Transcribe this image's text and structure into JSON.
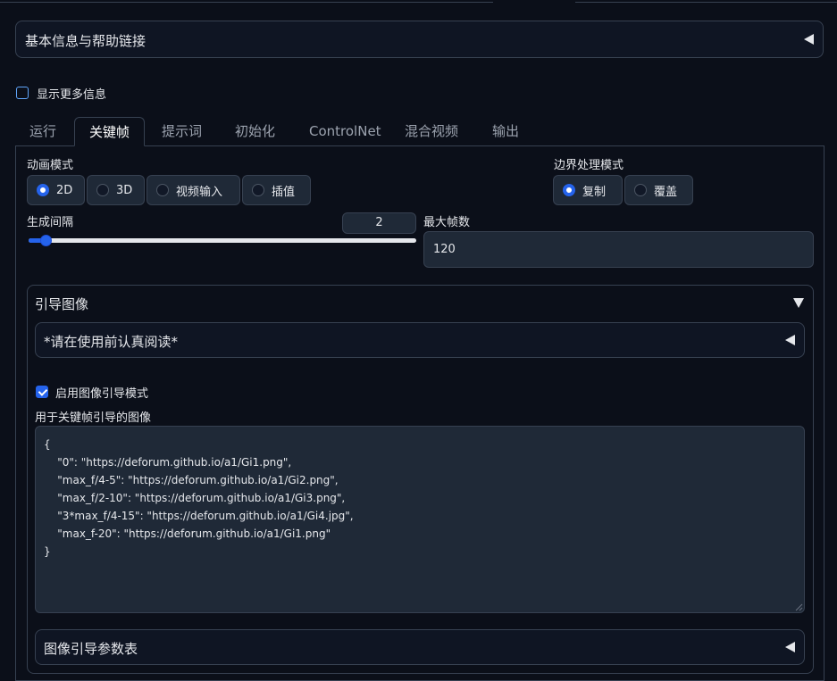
{
  "colors": {
    "accent": "#2563eb",
    "background": "#0b0f19",
    "border": "#374151",
    "input_bg": "#1f2937"
  },
  "top_accordion": {
    "title": "基本信息与帮助链接",
    "icon": "triangle-left-icon"
  },
  "show_more": {
    "label": "显示更多信息",
    "checked": false
  },
  "tabs": [
    {
      "label": "运行",
      "active": false
    },
    {
      "label": "关键帧",
      "active": true
    },
    {
      "label": "提示词",
      "active": false
    },
    {
      "label": "初始化",
      "active": false
    },
    {
      "label": "ControlNet",
      "active": false
    },
    {
      "label": "混合视频",
      "active": false
    },
    {
      "label": "输出",
      "active": false
    }
  ],
  "animation_mode": {
    "label": "动画模式",
    "options": [
      "2D",
      "3D",
      "视频输入",
      "插值"
    ],
    "selected": "2D"
  },
  "border_mode": {
    "label": "边界处理模式",
    "options": [
      "复制",
      "覆盖"
    ],
    "selected": "复制"
  },
  "cadence": {
    "label": "生成间隔",
    "value": "2",
    "fraction": 0.02
  },
  "max_frames": {
    "label": "最大帧数",
    "value": "120"
  },
  "guided_images": {
    "title": "引导图像",
    "readme_title": "*请在使用前认真阅读*",
    "enable_label": "启用图像引导模式",
    "enable_checked": true,
    "images_label": "用于关键帧引导的图像",
    "images_value": "{\n    \"0\": \"https://deforum.github.io/a1/Gi1.png\",\n    \"max_f/4-5\": \"https://deforum.github.io/a1/Gi2.png\",\n    \"max_f/2-10\": \"https://deforum.github.io/a1/Gi3.png\",\n    \"3*max_f/4-15\": \"https://deforum.github.io/a1/Gi4.jpg\",\n    \"max_f-20\": \"https://deforum.github.io/a1/Gi1.png\"\n}",
    "schedules_title": "图像引导参数表"
  }
}
